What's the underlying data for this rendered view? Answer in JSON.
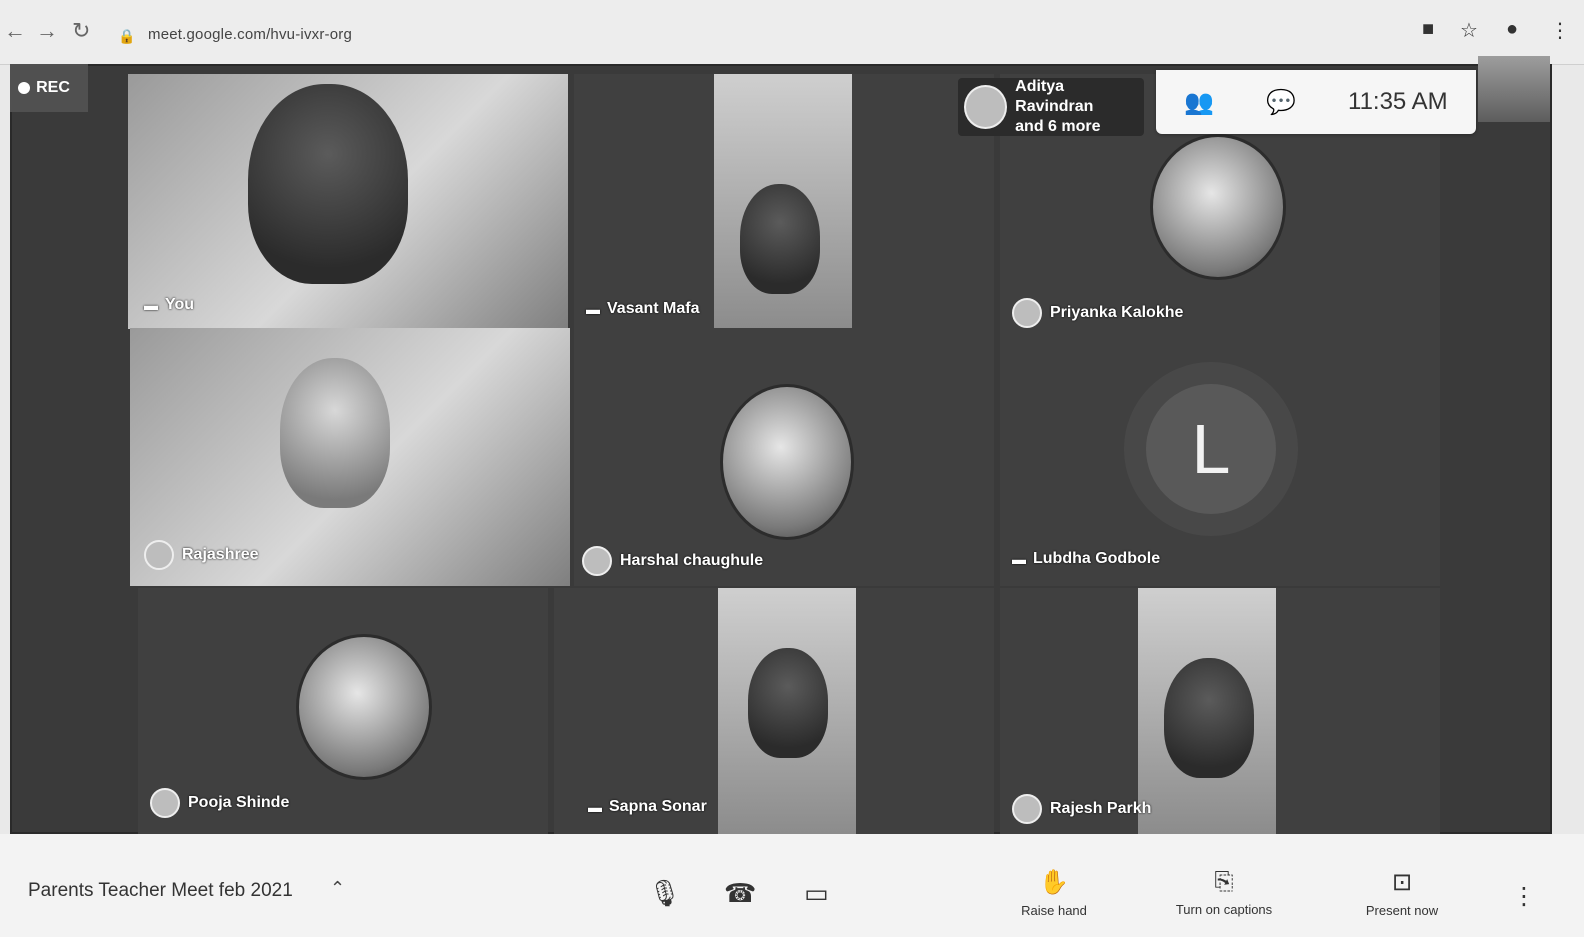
{
  "browser": {
    "url": "meet.google.com/hvu-ivxr-org",
    "icons": [
      "back-icon",
      "forward-icon",
      "reload-icon",
      "lock-icon",
      "camera-status-icon",
      "star-icon",
      "profile-icon"
    ]
  },
  "recording": {
    "label": "REC"
  },
  "participants_chip": {
    "line1": "Aditya Ravindran",
    "line2": "and 6 more"
  },
  "clock": "11:35 AM",
  "tiles": {
    "you": "You",
    "vasant": "Vasant Mafa",
    "priyanka": "Priyanka Kalokhe",
    "rajashree": "Rajashree",
    "harshal": "Harshal chaughule",
    "lubdha": "Lubdha Godbole",
    "lubdha_initial": "L",
    "pooja": "Pooja Shinde",
    "sapna": "Sapna Sonar",
    "rajesh": "Rajesh Parkh"
  },
  "bottom": {
    "meeting_title": "Parents Teacher Meet feb 2021",
    "raise_hand": "Raise hand",
    "captions": "Turn on captions",
    "present": "Present now"
  }
}
